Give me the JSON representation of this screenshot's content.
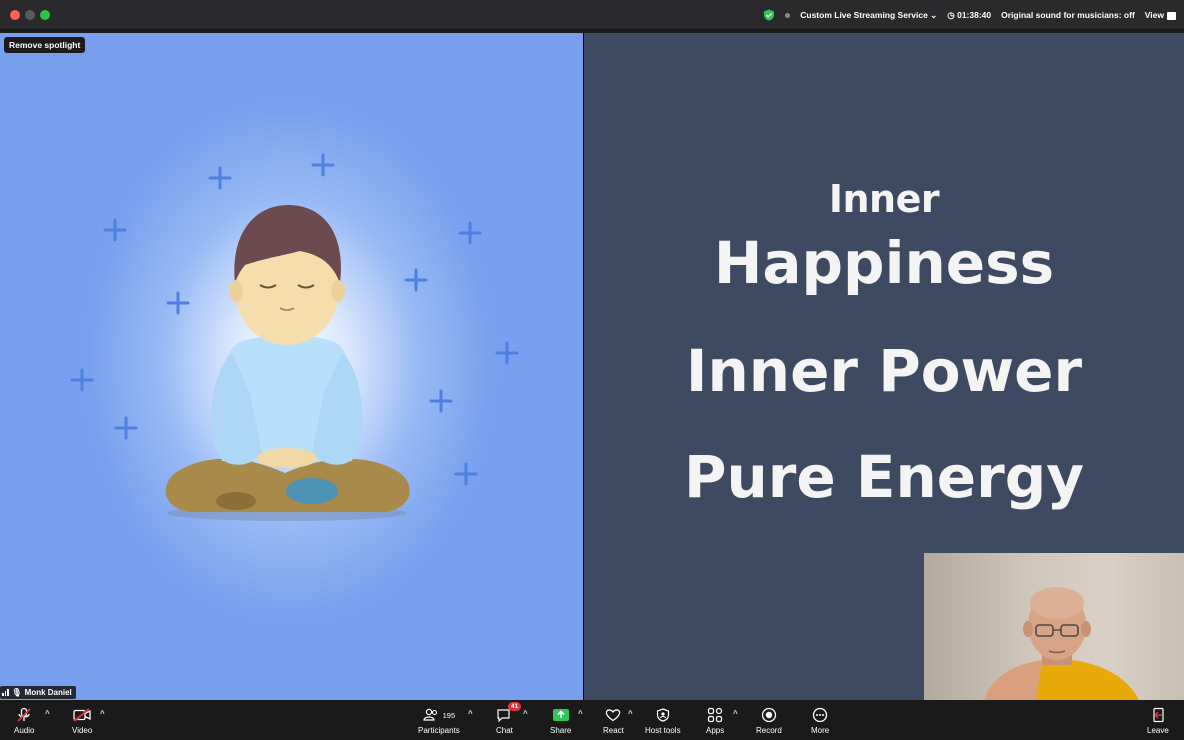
{
  "titlebar": {
    "streaming_label": "Custom Live Streaming Service",
    "timer": "01:38:40",
    "original_sound": "Original sound for musicians: off",
    "view_label": "View"
  },
  "stage": {
    "spotlight_button": "Remove spotlight",
    "participant_name": "Monk Daniel",
    "slide": {
      "line1": "Inner",
      "line2": "Happiness",
      "line3": "Inner Power",
      "line4": "Pure Energy"
    }
  },
  "toolbar": {
    "audio": "Audio",
    "video": "Video",
    "participants": "Participants",
    "participants_count": "195",
    "chat": "Chat",
    "chat_badge": "41",
    "share": "Share",
    "react": "React",
    "host_tools": "Host tools",
    "apps": "Apps",
    "record": "Record",
    "more": "More",
    "leave": "Leave"
  },
  "colors": {
    "left_pane": "#789fee",
    "right_pane": "#3e4a61",
    "share_green": "#2fc55b",
    "badge_red": "#e0323c"
  }
}
